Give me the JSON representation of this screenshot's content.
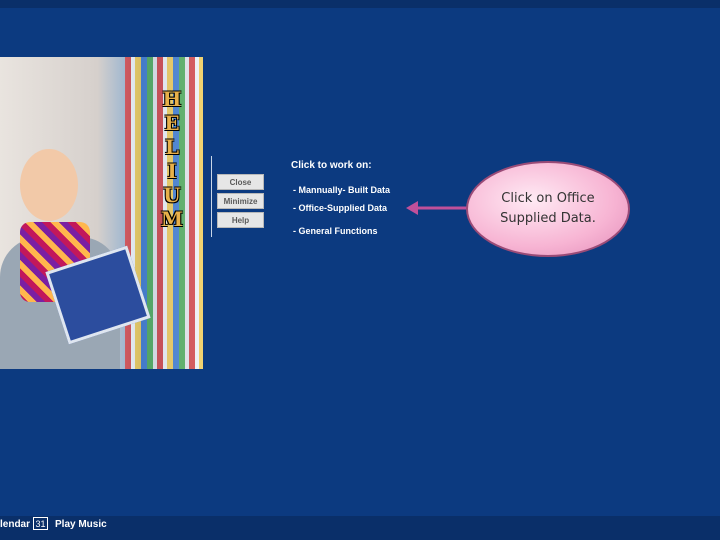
{
  "app": {
    "logo_letters": [
      "H",
      "E",
      "L",
      "I",
      "U",
      "M"
    ]
  },
  "buttons": {
    "close": "Close",
    "minimize": "Minimize",
    "help": "Help"
  },
  "menu": {
    "heading": "Click to work on:",
    "options": [
      "- Mannually- Built  Data",
      "- Office-Supplied  Data",
      "- General   Functions"
    ]
  },
  "callout": {
    "text": "Click on Office Supplied Data."
  },
  "bottom_bar": {
    "calendar_label": "lendar",
    "box_value": "31",
    "music_label": "Play Music"
  },
  "colors": {
    "background": "#0c3a80",
    "callout_fill": "#f7b4d3",
    "arrow": "#c0509a"
  }
}
